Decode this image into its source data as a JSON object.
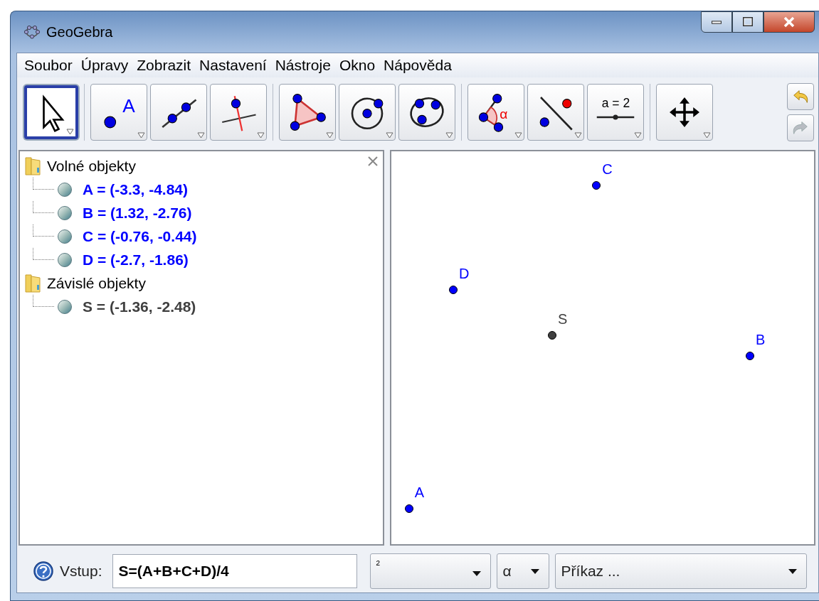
{
  "window": {
    "title": "GeoGebra"
  },
  "menu": [
    "Soubor",
    "Úpravy",
    "Zobrazit",
    "Nastavení",
    "Nástroje",
    "Okno",
    "Nápověda"
  ],
  "toolbar": [
    [
      {
        "kind": "move",
        "selected": true
      }
    ],
    [
      {
        "kind": "point",
        "selected": false,
        "icon_text": "A"
      },
      {
        "kind": "line",
        "selected": false
      },
      {
        "kind": "perpendicular",
        "selected": false
      }
    ],
    [
      {
        "kind": "polygon",
        "selected": false
      },
      {
        "kind": "circle",
        "selected": false
      },
      {
        "kind": "conic",
        "selected": false
      }
    ],
    [
      {
        "kind": "angle",
        "selected": false,
        "icon_text": "α"
      },
      {
        "kind": "reflect",
        "selected": false
      },
      {
        "kind": "slider",
        "selected": false,
        "icon_text": "a = 2"
      }
    ],
    [
      {
        "kind": "move_view",
        "selected": false
      }
    ]
  ],
  "history": [
    {
      "kind": "undo",
      "disabled": false
    },
    {
      "kind": "redo",
      "disabled": true
    }
  ],
  "algebra_view": {
    "folders": [
      {
        "title": "Volné objekty",
        "children": [
          {
            "text": "A = (-3.3, -4.84)",
            "color": "#0000ff"
          },
          {
            "text": "B = (1.32, -2.76)",
            "color": "#0000ff"
          },
          {
            "text": "C = (-0.76, -0.44)",
            "color": "#0000ff"
          },
          {
            "text": "D = (-2.7, -1.86)",
            "color": "#0000ff"
          }
        ]
      },
      {
        "title": "Závislé objekty",
        "children": [
          {
            "text": "S = (-1.36, -2.48)",
            "color": "#404040"
          }
        ]
      }
    ]
  },
  "graphics_view": {
    "points": [
      {
        "label": "A",
        "color": "#0000ff"
      },
      {
        "label": "B",
        "color": "#0000ff"
      },
      {
        "label": "C",
        "color": "#0000ff"
      },
      {
        "label": "D",
        "color": "#0000ff"
      },
      {
        "label": "S",
        "color": "#404040"
      }
    ]
  },
  "input_bar": {
    "label": "Vstup:",
    "value": "S=(A+B+C+D)/4",
    "dropdowns": [
      "²",
      "α",
      "Příkaz ..."
    ]
  }
}
